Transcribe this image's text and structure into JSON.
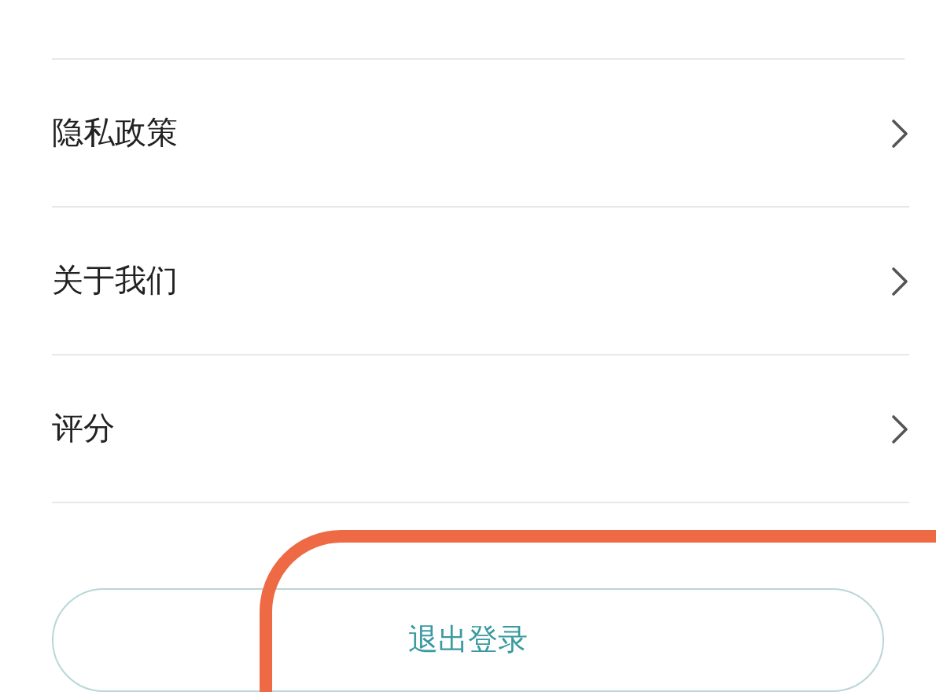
{
  "menu_items": [
    {
      "label": "隐私政策"
    },
    {
      "label": "关于我们"
    },
    {
      "label": "评分"
    }
  ],
  "logout_button": {
    "label": "退出登录"
  }
}
